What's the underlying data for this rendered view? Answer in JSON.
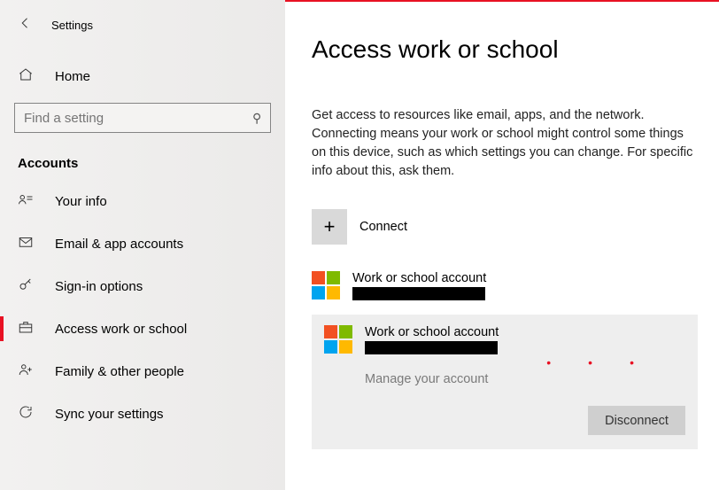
{
  "header": {
    "title": "Settings"
  },
  "sidebar": {
    "home": "Home",
    "search_placeholder": "Find a setting",
    "section": "Accounts",
    "items": [
      {
        "label": "Your info"
      },
      {
        "label": "Email & app accounts"
      },
      {
        "label": "Sign-in options"
      },
      {
        "label": "Access work or school"
      },
      {
        "label": "Family & other people"
      },
      {
        "label": "Sync your settings"
      }
    ]
  },
  "main": {
    "heading": "Access work or school",
    "description": "Get access to resources like email, apps, and the network. Connecting means your work or school might control some things on this device, such as which settings you can change. For specific info about this, ask them.",
    "connect_label": "Connect",
    "accounts": [
      {
        "title": "Work or school account"
      },
      {
        "title": "Work or school account"
      }
    ],
    "manage_label": "Manage your account",
    "disconnect_label": "Disconnect"
  }
}
